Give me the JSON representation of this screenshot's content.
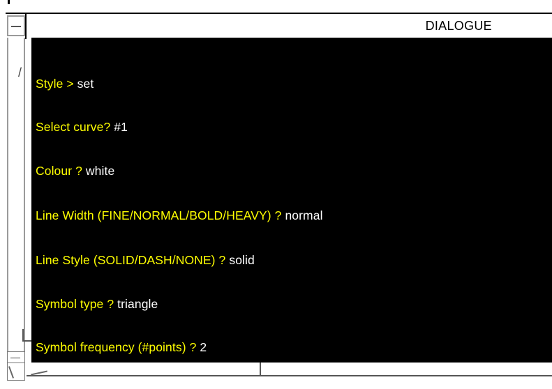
{
  "window": {
    "title": "DIALOGUE"
  },
  "dialogue": {
    "lines": [
      {
        "prompt": "Style > ",
        "answer": "set"
      },
      {
        "prompt": "Select curve? ",
        "answer": "#1"
      },
      {
        "prompt": "Colour ? ",
        "answer": "white"
      },
      {
        "prompt": "Line Width (FINE/NORMAL/BOLD/HEAVY) ? ",
        "answer": "normal"
      },
      {
        "prompt": "Line Style (SOLID/DASH/NONE) ? ",
        "answer": "solid"
      },
      {
        "prompt": "Symbol type ? ",
        "answer": "triangle"
      },
      {
        "prompt": "Symbol frequency (#points) ? ",
        "answer": "2"
      }
    ]
  },
  "colors": {
    "panel_background": "#000000",
    "prompt_text": "#ffff00",
    "answer_text": "#ffffff"
  },
  "icons": {
    "window_menu": "dash-icon",
    "resize_corner": "slash-icon"
  }
}
